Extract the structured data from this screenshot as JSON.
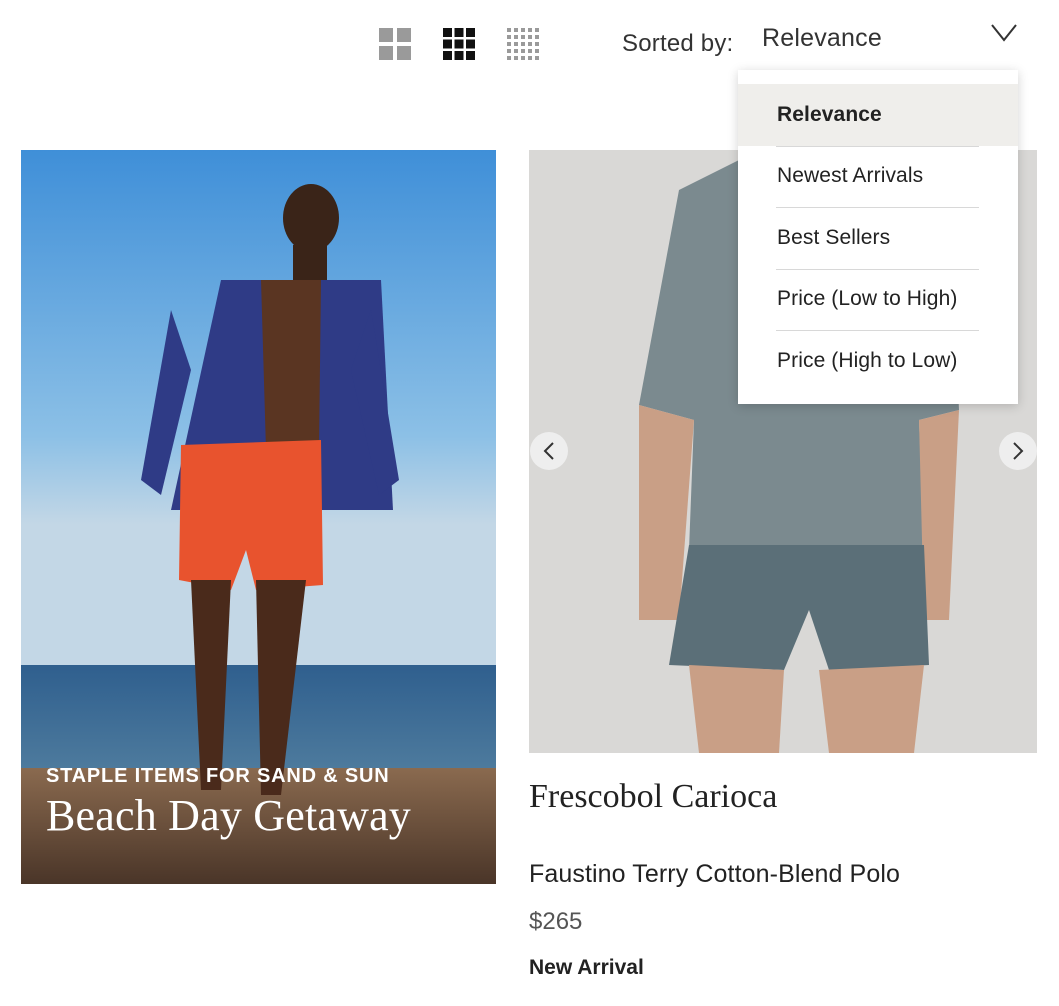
{
  "toolbar": {
    "grid_views": [
      {
        "icon": "grid-2x2-icon",
        "active": false
      },
      {
        "icon": "grid-3x3-icon",
        "active": true
      },
      {
        "icon": "grid-5x5-icon",
        "active": false
      }
    ],
    "sort_label": "Sorted by:",
    "sort_value": "Relevance",
    "chevron_icon": "chevron-down-icon"
  },
  "sort_dropdown": {
    "options": [
      {
        "label": "Relevance",
        "selected": true
      },
      {
        "label": "Newest Arrivals",
        "selected": false
      },
      {
        "label": "Best Sellers",
        "selected": false
      },
      {
        "label": "Price (Low to High)",
        "selected": false
      },
      {
        "label": "Price (High to Low)",
        "selected": false
      }
    ]
  },
  "promo": {
    "eyebrow": "STAPLE ITEMS FOR SAND & SUN",
    "title": "Beach Day Getaway"
  },
  "product": {
    "brand": "Frescobol Carioca",
    "name": "Faustino Terry Cotton-Blend Polo",
    "price": "$265",
    "badge": "New Arrival",
    "carousel_prev_icon": "chevron-left-icon",
    "carousel_next_icon": "chevron-right-icon"
  },
  "colors": {
    "selected_option_bg": "#efeeeb",
    "active_grid_icon": "#111111",
    "inactive_grid_icon": "#9a9a9a"
  }
}
